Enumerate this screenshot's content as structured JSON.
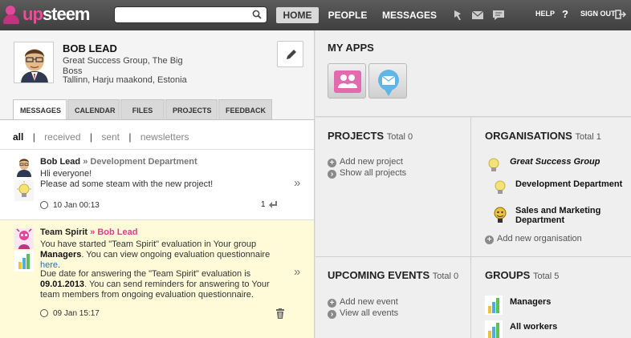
{
  "header": {
    "logo_text_prefix": "up",
    "logo_text_suffix": "steem",
    "search_placeholder": "",
    "nav": [
      "HOME",
      "PEOPLE",
      "MESSAGES"
    ],
    "help": "HELP",
    "help_q": "?",
    "signout": "SIGN OUT"
  },
  "profile": {
    "name": "BOB LEAD",
    "org": "Great Success Group, The Big Boss",
    "location": "Tallinn, Harju maakond, Estonia"
  },
  "tabs": [
    "MESSAGES",
    "CALENDAR",
    "FILES",
    "PROJECTS",
    "FEEDBACK"
  ],
  "filters": {
    "all": "all",
    "received": "received",
    "sent": "sent",
    "newsletters": "newsletters",
    "sep": "|"
  },
  "messages": [
    {
      "from": "Bob Lead",
      "arrow": "»",
      "to": "Development Department",
      "line1": "Hli everyone!",
      "line2": "Please ad some steam with the new project!",
      "time": "10 Jan 00:13",
      "reply_count": "1"
    },
    {
      "from": "Team Spirit",
      "arrow": "»",
      "to": "Bob Lead",
      "p1_a": "You have started \"Team Spirit\" evaluation in Your group ",
      "p1_b": "Managers",
      "p1_c": ". You can view ongoing evaluation questionnaire ",
      "p1_link": "here",
      "p1_d": ".",
      "p2_a": "Due date for answering the \"Team Spirit\" evaluation is ",
      "p2_b": "09.01.2013",
      "p2_c": ". You can send reminders for answering to Your team members from ongoing evaluation questionnaire.",
      "time": "09 Jan 15:17"
    }
  ],
  "chevron": "»",
  "right": {
    "myapps_title": "MY APPS",
    "projects": {
      "title": "PROJECTS",
      "total": "Total 0",
      "add": "Add new project",
      "show": "Show all projects"
    },
    "organisations": {
      "title": "ORGANISATIONS",
      "total": "Total 1",
      "items": [
        "Great Success Group",
        "Development Department",
        "Sales and Marketing Department"
      ],
      "add": "Add new organisation"
    },
    "events": {
      "title": "UPCOMING EVENTS",
      "total": "Total 0",
      "add": "Add new event",
      "view": "View all events"
    },
    "groups": {
      "title": "GROUPS",
      "total": "Total 5",
      "items": [
        "Managers",
        "All workers"
      ]
    }
  },
  "colors": {
    "accent": "#ea4c9c",
    "topbar": "#4a4a4a",
    "highlight": "#fffbd9",
    "link": "#2b6db5"
  }
}
